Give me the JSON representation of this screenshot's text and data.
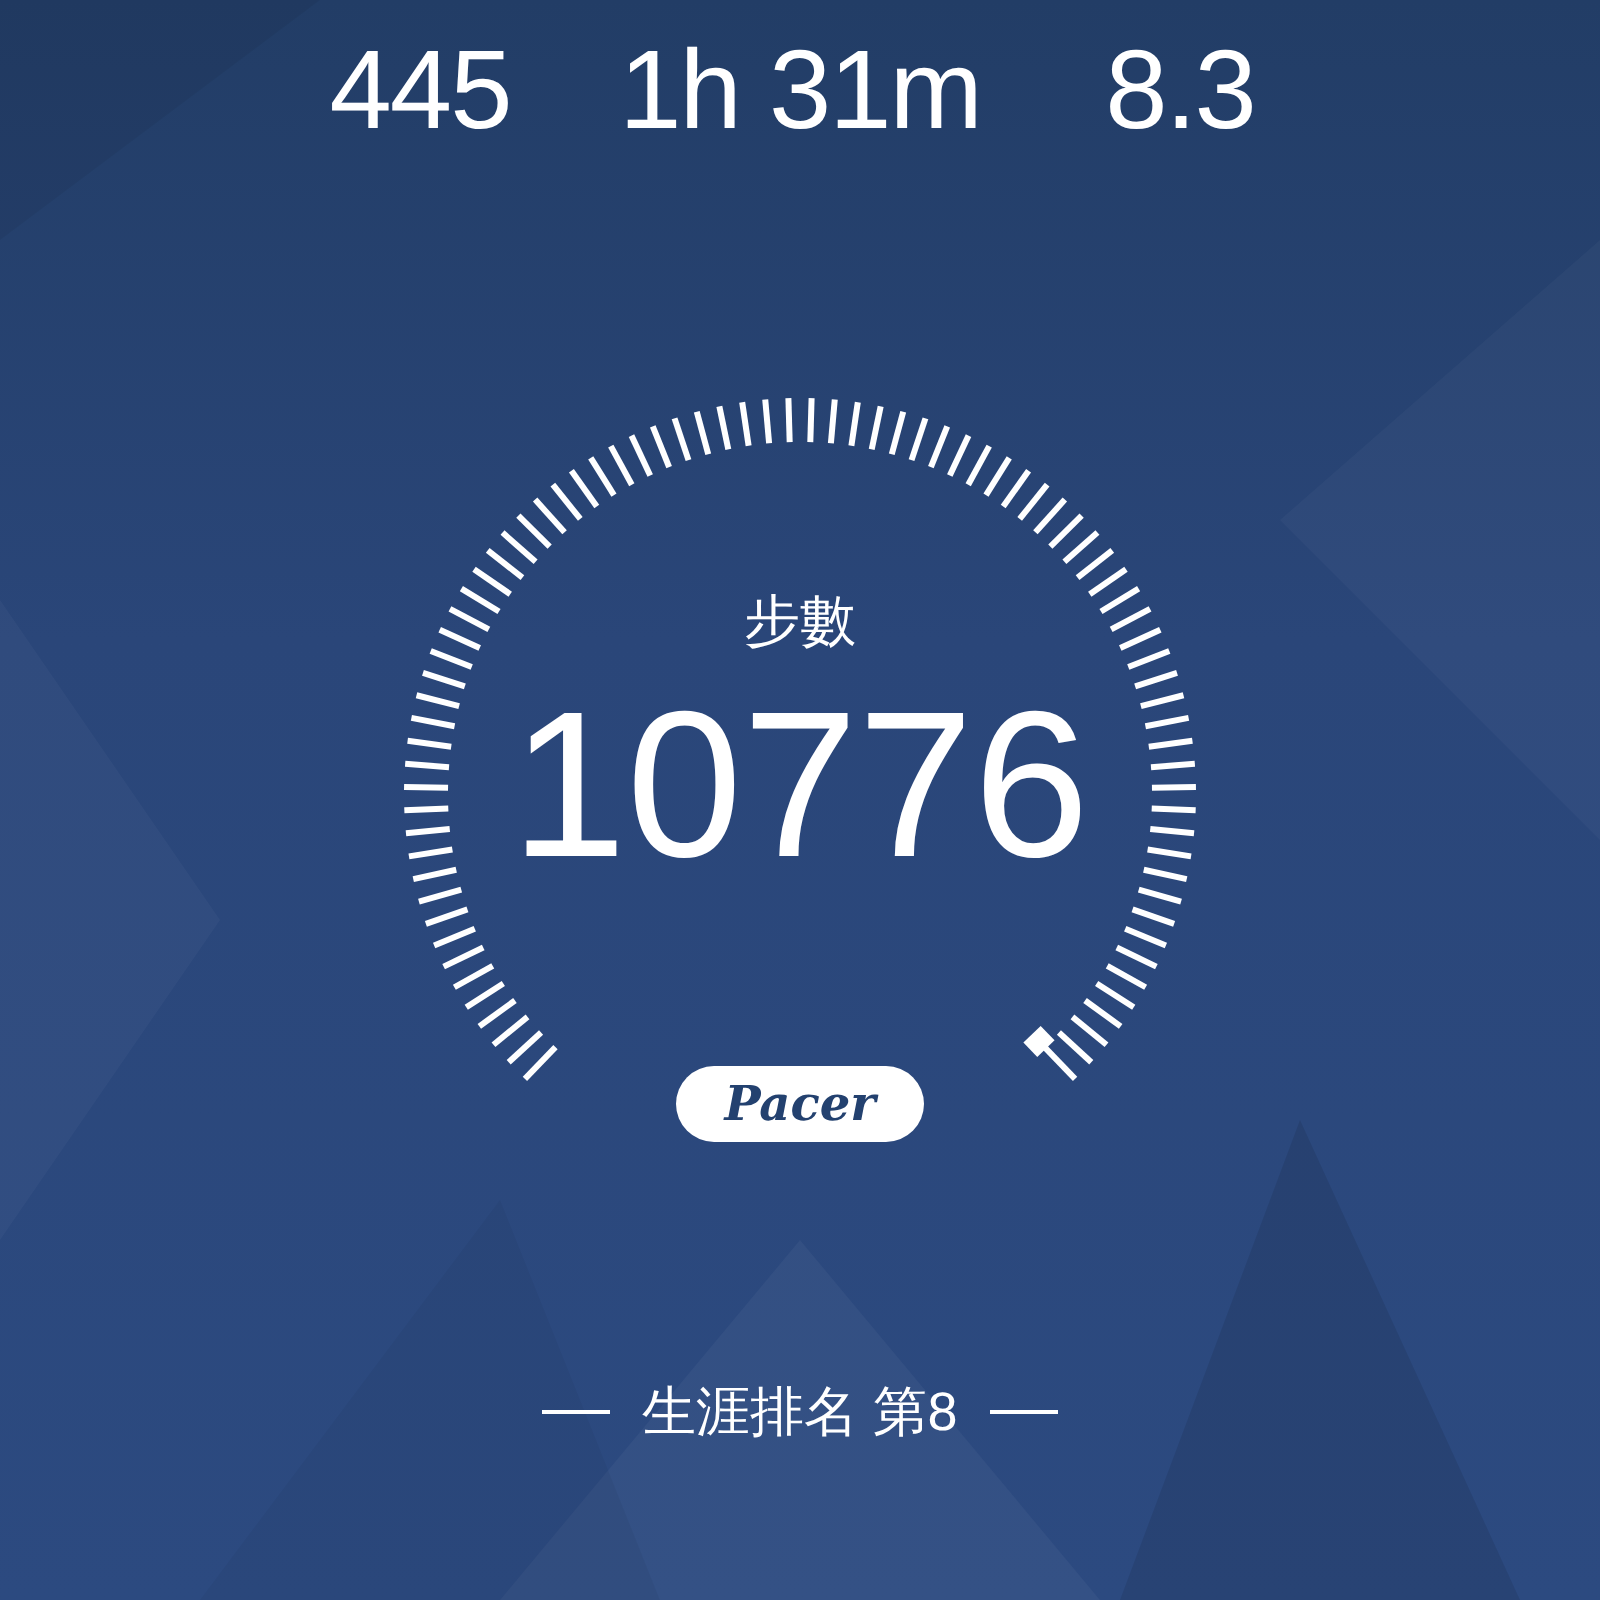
{
  "stats": [
    {
      "value": "445"
    },
    {
      "value": "1h 31m"
    },
    {
      "value": "8.3"
    }
  ],
  "gauge": {
    "label": "步數",
    "value": "10776"
  },
  "badge": "Pacer",
  "ranking": "生涯排名 第8"
}
